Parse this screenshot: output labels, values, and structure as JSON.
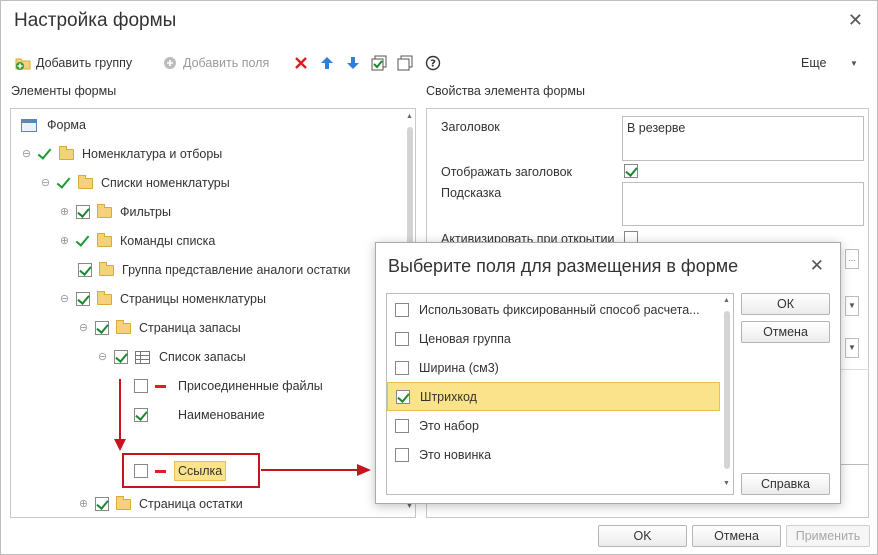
{
  "window": {
    "title": "Настройка формы"
  },
  "toolbar": {
    "add_group": "Добавить группу",
    "add_fields": "Добавить поля",
    "more": "Еще"
  },
  "left_panel": {
    "title": "Элементы формы",
    "tree": [
      {
        "label": "Форма"
      },
      {
        "label": "Номенклатура и отборы"
      },
      {
        "label": "Списки номенклатуры"
      },
      {
        "label": "Фильтры"
      },
      {
        "label": "Команды списка"
      },
      {
        "label": "Группа представление аналоги остатки"
      },
      {
        "label": "Страницы номенклатуры"
      },
      {
        "label": "Страница запасы"
      },
      {
        "label": "Список запасы"
      },
      {
        "label": "Присоединенные файлы"
      },
      {
        "label": "Наименование"
      },
      {
        "label": "Ссылка"
      },
      {
        "label": "Страница остатки"
      }
    ]
  },
  "right_panel": {
    "title": "Свойства элемента формы",
    "header_label": "Заголовок",
    "header_value": "В резерве",
    "show_header_label": "Отображать заголовок",
    "hint_label": "Подсказка",
    "hint_value": "",
    "activate_label": "Активизировать при открытии"
  },
  "dialog": {
    "title": "Выберите поля для размещения в форме",
    "ok": "ОК",
    "cancel": "Отмена",
    "help": "Справка",
    "items": [
      {
        "label": "Использовать фиксированный способ расчета...",
        "checked": false
      },
      {
        "label": "Ценовая группа",
        "checked": false
      },
      {
        "label": "Ширина (см3)",
        "checked": false
      },
      {
        "label": "Штрихкод",
        "checked": true
      },
      {
        "label": "Это набор",
        "checked": false
      },
      {
        "label": "Это новинка",
        "checked": false
      }
    ]
  },
  "footer": {
    "ok": "OK",
    "cancel": "Отмена",
    "apply": "Применить"
  },
  "colors": {
    "accent_red": "#c8141c",
    "check_green": "#1a9a2e",
    "selection_yellow": "#fbe38c"
  }
}
